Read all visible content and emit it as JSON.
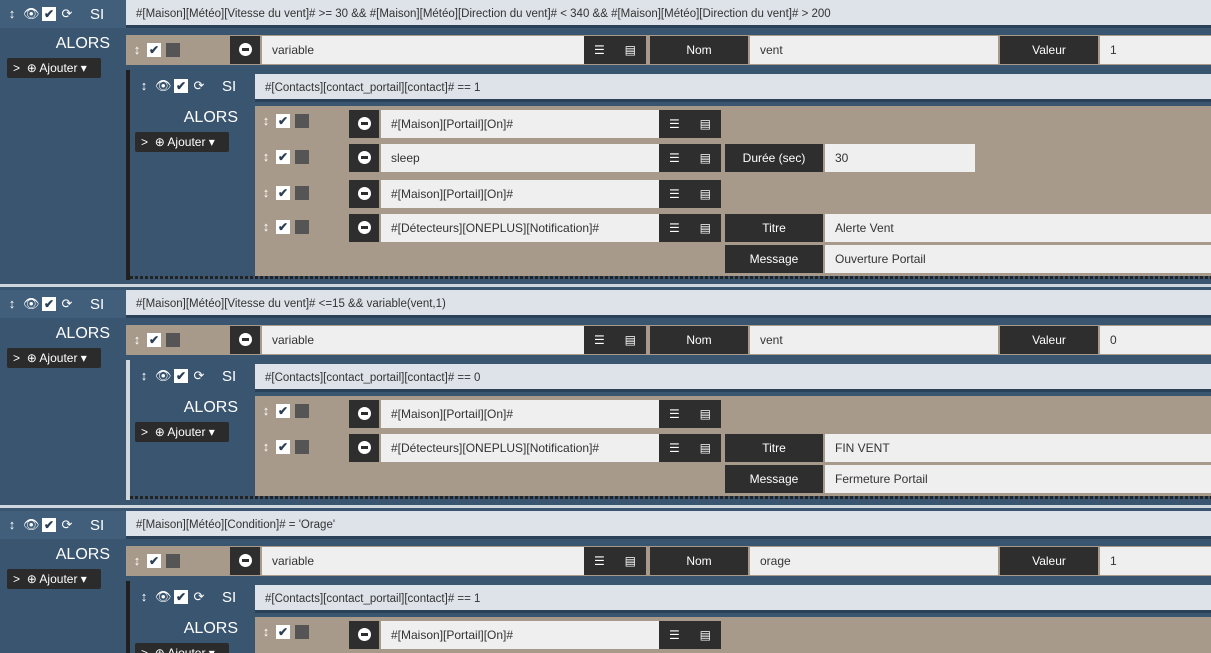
{
  "labels": {
    "si": "SI",
    "alors": "ALORS",
    "ajouter": "Ajouter"
  },
  "blocks": [
    {
      "condition": "#[Maison][Météo][Vitesse du vent]# >= 30 && #[Maison][Météo][Direction du vent]# < 340 && #[Maison][Météo][Direction du vent]# > 200",
      "action": {
        "cmd": "variable",
        "l1": "Nom",
        "v1": "vent",
        "l2": "Valeur",
        "v2": "1"
      },
      "sub": {
        "condition": "#[Contacts][contact_portail][contact]# == 1",
        "actions": [
          {
            "cmd": "#[Maison][Portail][On]#"
          },
          {
            "cmd": "sleep",
            "l1": "Durée (sec)",
            "v1": "30"
          },
          {
            "cmd": "#[Maison][Portail][On]#"
          },
          {
            "cmd": "#[Détecteurs][ONEPLUS][Notification]#",
            "l1": "Titre",
            "v1": "Alerte Vent",
            "l2": "Message",
            "v2": "Ouverture Portail"
          }
        ]
      }
    },
    {
      "condition": "#[Maison][Météo][Vitesse du vent]# <=15 && variable(vent,1)",
      "action": {
        "cmd": "variable",
        "l1": "Nom",
        "v1": "vent",
        "l2": "Valeur",
        "v2": "0"
      },
      "sub": {
        "condition": "#[Contacts][contact_portail][contact]# == 0",
        "actions": [
          {
            "cmd": "#[Maison][Portail][On]#"
          },
          {
            "cmd": "#[Détecteurs][ONEPLUS][Notification]#",
            "l1": "Titre",
            "v1": "FIN VENT",
            "l2": "Message",
            "v2": "Fermeture Portail"
          }
        ]
      }
    },
    {
      "condition": "#[Maison][Météo][Condition]# = 'Orage'",
      "action": {
        "cmd": "variable",
        "l1": "Nom",
        "v1": "orage",
        "l2": "Valeur",
        "v2": "1"
      },
      "sub": {
        "condition": "#[Contacts][contact_portail][contact]# == 1",
        "actions": [
          {
            "cmd": "#[Maison][Portail][On]#"
          }
        ]
      }
    }
  ]
}
